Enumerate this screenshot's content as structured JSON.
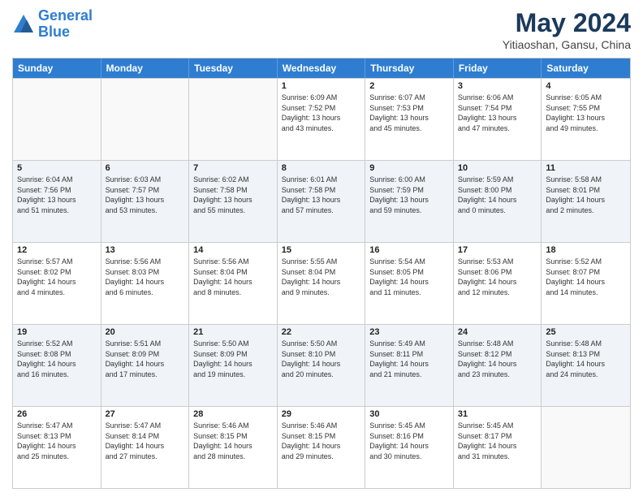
{
  "logo": {
    "line1": "General",
    "line2": "Blue"
  },
  "title": "May 2024",
  "subtitle": "Yitiaoshan, Gansu, China",
  "days_of_week": [
    "Sunday",
    "Monday",
    "Tuesday",
    "Wednesday",
    "Thursday",
    "Friday",
    "Saturday"
  ],
  "weeks": [
    [
      {
        "day": "",
        "info": ""
      },
      {
        "day": "",
        "info": ""
      },
      {
        "day": "",
        "info": ""
      },
      {
        "day": "1",
        "info": "Sunrise: 6:09 AM\nSunset: 7:52 PM\nDaylight: 13 hours\nand 43 minutes."
      },
      {
        "day": "2",
        "info": "Sunrise: 6:07 AM\nSunset: 7:53 PM\nDaylight: 13 hours\nand 45 minutes."
      },
      {
        "day": "3",
        "info": "Sunrise: 6:06 AM\nSunset: 7:54 PM\nDaylight: 13 hours\nand 47 minutes."
      },
      {
        "day": "4",
        "info": "Sunrise: 6:05 AM\nSunset: 7:55 PM\nDaylight: 13 hours\nand 49 minutes."
      }
    ],
    [
      {
        "day": "5",
        "info": "Sunrise: 6:04 AM\nSunset: 7:56 PM\nDaylight: 13 hours\nand 51 minutes."
      },
      {
        "day": "6",
        "info": "Sunrise: 6:03 AM\nSunset: 7:57 PM\nDaylight: 13 hours\nand 53 minutes."
      },
      {
        "day": "7",
        "info": "Sunrise: 6:02 AM\nSunset: 7:58 PM\nDaylight: 13 hours\nand 55 minutes."
      },
      {
        "day": "8",
        "info": "Sunrise: 6:01 AM\nSunset: 7:58 PM\nDaylight: 13 hours\nand 57 minutes."
      },
      {
        "day": "9",
        "info": "Sunrise: 6:00 AM\nSunset: 7:59 PM\nDaylight: 13 hours\nand 59 minutes."
      },
      {
        "day": "10",
        "info": "Sunrise: 5:59 AM\nSunset: 8:00 PM\nDaylight: 14 hours\nand 0 minutes."
      },
      {
        "day": "11",
        "info": "Sunrise: 5:58 AM\nSunset: 8:01 PM\nDaylight: 14 hours\nand 2 minutes."
      }
    ],
    [
      {
        "day": "12",
        "info": "Sunrise: 5:57 AM\nSunset: 8:02 PM\nDaylight: 14 hours\nand 4 minutes."
      },
      {
        "day": "13",
        "info": "Sunrise: 5:56 AM\nSunset: 8:03 PM\nDaylight: 14 hours\nand 6 minutes."
      },
      {
        "day": "14",
        "info": "Sunrise: 5:56 AM\nSunset: 8:04 PM\nDaylight: 14 hours\nand 8 minutes."
      },
      {
        "day": "15",
        "info": "Sunrise: 5:55 AM\nSunset: 8:04 PM\nDaylight: 14 hours\nand 9 minutes."
      },
      {
        "day": "16",
        "info": "Sunrise: 5:54 AM\nSunset: 8:05 PM\nDaylight: 14 hours\nand 11 minutes."
      },
      {
        "day": "17",
        "info": "Sunrise: 5:53 AM\nSunset: 8:06 PM\nDaylight: 14 hours\nand 12 minutes."
      },
      {
        "day": "18",
        "info": "Sunrise: 5:52 AM\nSunset: 8:07 PM\nDaylight: 14 hours\nand 14 minutes."
      }
    ],
    [
      {
        "day": "19",
        "info": "Sunrise: 5:52 AM\nSunset: 8:08 PM\nDaylight: 14 hours\nand 16 minutes."
      },
      {
        "day": "20",
        "info": "Sunrise: 5:51 AM\nSunset: 8:09 PM\nDaylight: 14 hours\nand 17 minutes."
      },
      {
        "day": "21",
        "info": "Sunrise: 5:50 AM\nSunset: 8:09 PM\nDaylight: 14 hours\nand 19 minutes."
      },
      {
        "day": "22",
        "info": "Sunrise: 5:50 AM\nSunset: 8:10 PM\nDaylight: 14 hours\nand 20 minutes."
      },
      {
        "day": "23",
        "info": "Sunrise: 5:49 AM\nSunset: 8:11 PM\nDaylight: 14 hours\nand 21 minutes."
      },
      {
        "day": "24",
        "info": "Sunrise: 5:48 AM\nSunset: 8:12 PM\nDaylight: 14 hours\nand 23 minutes."
      },
      {
        "day": "25",
        "info": "Sunrise: 5:48 AM\nSunset: 8:13 PM\nDaylight: 14 hours\nand 24 minutes."
      }
    ],
    [
      {
        "day": "26",
        "info": "Sunrise: 5:47 AM\nSunset: 8:13 PM\nDaylight: 14 hours\nand 25 minutes."
      },
      {
        "day": "27",
        "info": "Sunrise: 5:47 AM\nSunset: 8:14 PM\nDaylight: 14 hours\nand 27 minutes."
      },
      {
        "day": "28",
        "info": "Sunrise: 5:46 AM\nSunset: 8:15 PM\nDaylight: 14 hours\nand 28 minutes."
      },
      {
        "day": "29",
        "info": "Sunrise: 5:46 AM\nSunset: 8:15 PM\nDaylight: 14 hours\nand 29 minutes."
      },
      {
        "day": "30",
        "info": "Sunrise: 5:45 AM\nSunset: 8:16 PM\nDaylight: 14 hours\nand 30 minutes."
      },
      {
        "day": "31",
        "info": "Sunrise: 5:45 AM\nSunset: 8:17 PM\nDaylight: 14 hours\nand 31 minutes."
      },
      {
        "day": "",
        "info": ""
      }
    ]
  ]
}
